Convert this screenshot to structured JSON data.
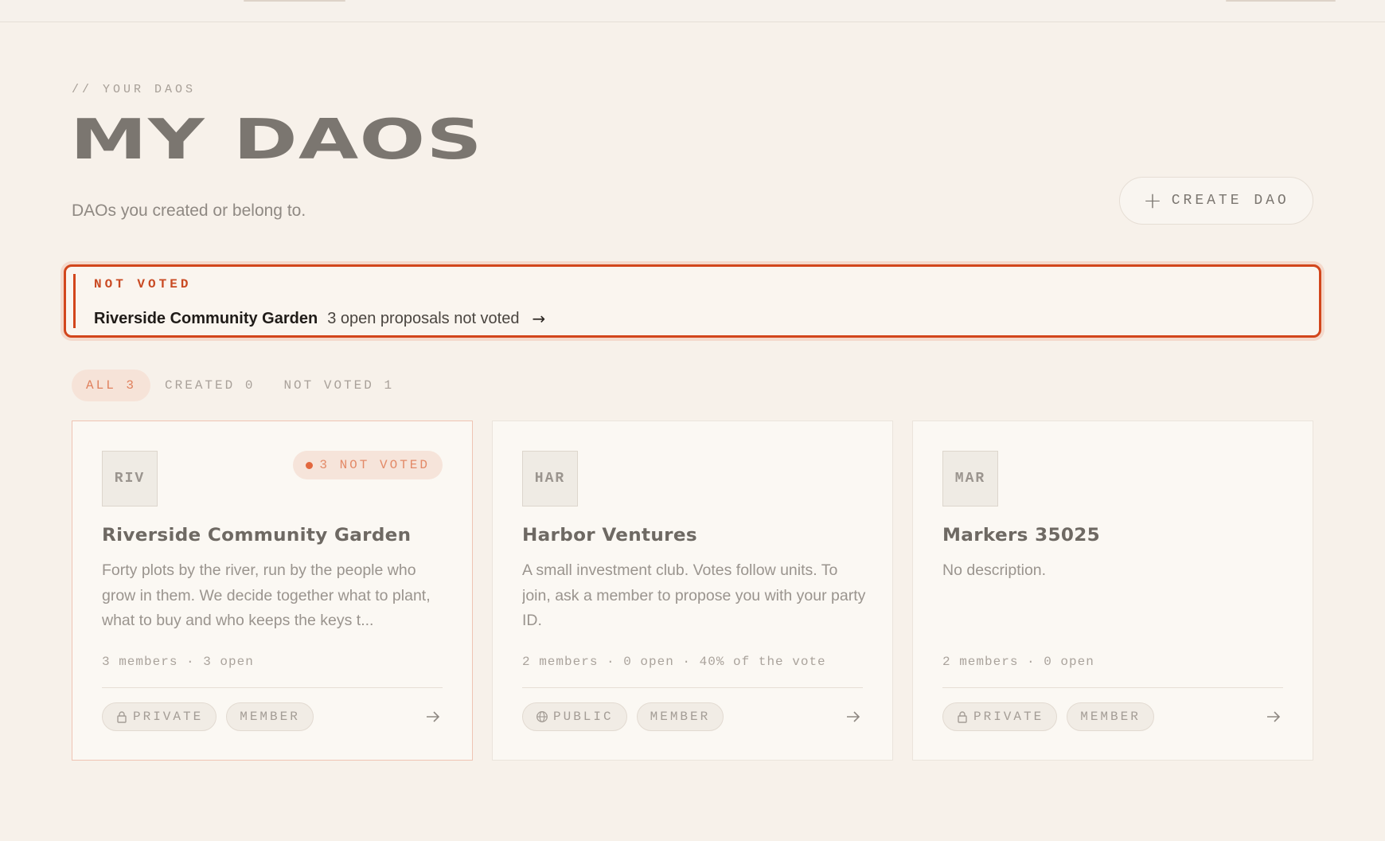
{
  "header": {
    "eyebrow": "// YOUR DAOS",
    "title": "MY DAOS",
    "subtitle": "DAOs you created or belong to.",
    "create_button": "CREATE DAO"
  },
  "alert": {
    "label": "NOT VOTED",
    "dao_name": "Riverside Community Garden",
    "message": "3 open proposals not voted"
  },
  "filters": [
    {
      "label": "ALL 3",
      "active": true
    },
    {
      "label": "CREATED 0",
      "active": false
    },
    {
      "label": "NOT VOTED 1",
      "active": false
    }
  ],
  "cards": [
    {
      "initials": "RIV",
      "badge": "3 NOT VOTED",
      "name": "Riverside Community Garden",
      "description": "Forty plots by the river, run by the people who grow in them. We decide together what to plant, what to buy and who keeps the keys t...",
      "stats": "3 members · 3 open",
      "visibility": "PRIVATE",
      "visibility_icon": "lock-icon",
      "role": "MEMBER"
    },
    {
      "initials": "HAR",
      "name": "Harbor Ventures",
      "description": "A small investment club. Votes follow units. To join, ask a member to propose you with your party ID.",
      "stats": "2 members · 0 open · 40% of the vote",
      "visibility": "PUBLIC",
      "visibility_icon": "globe-icon",
      "role": "MEMBER"
    },
    {
      "initials": "MAR",
      "name": "Markers 35025",
      "description": "No description.",
      "stats": "2 members · 0 open",
      "visibility": "PRIVATE",
      "visibility_icon": "lock-icon",
      "role": "MEMBER"
    }
  ],
  "colors": {
    "background": "#f7f1ea",
    "accent": "#d2461c",
    "badge_text": "#e38a68",
    "card_bg": "#fbf8f3"
  }
}
